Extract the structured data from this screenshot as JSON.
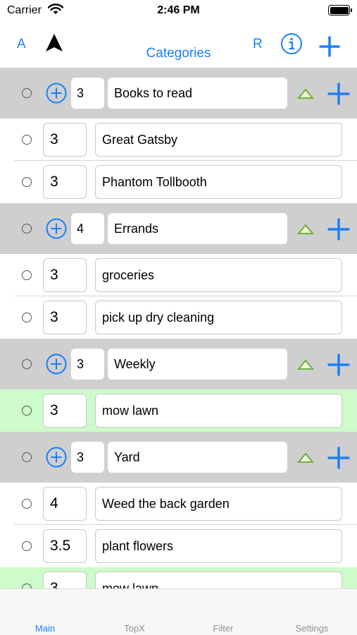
{
  "status_bar": {
    "carrier": "Carrier",
    "time": "2:46 PM"
  },
  "nav": {
    "left_label": "A",
    "title": "Categories",
    "right_label": "R",
    "icons": [
      "location-arrow-icon",
      "info-icon",
      "plus-icon"
    ]
  },
  "colors": {
    "accent": "#1a7ff7",
    "header_bg": "#cfcfcf",
    "highlight_bg": "#cdfbc9",
    "triangle": "#8bc34a"
  },
  "categories": [
    {
      "count": "3",
      "name": "Books to read",
      "items": [
        {
          "count": "3",
          "name": "Great Gatsby"
        },
        {
          "count": "3",
          "name": "Phantom Tollbooth"
        }
      ]
    },
    {
      "count": "4",
      "name": "Errands",
      "items": [
        {
          "count": "3",
          "name": "groceries"
        },
        {
          "count": "3",
          "name": "pick up dry cleaning"
        }
      ]
    },
    {
      "count": "3",
      "name": "Weekly",
      "items": [
        {
          "count": "3",
          "name": "mow lawn",
          "highlighted": true
        }
      ]
    },
    {
      "count": "3",
      "name": "Yard",
      "items": [
        {
          "count": "4",
          "name": "Weed the back garden"
        },
        {
          "count": "3.5",
          "name": "plant flowers"
        },
        {
          "count": "3",
          "name": "mow lawn",
          "highlighted": true
        }
      ]
    }
  ],
  "tabs": [
    {
      "label": "Main",
      "active": true
    },
    {
      "label": "TopX",
      "active": false
    },
    {
      "label": "Filter",
      "active": false
    },
    {
      "label": "Settings",
      "active": false
    }
  ]
}
